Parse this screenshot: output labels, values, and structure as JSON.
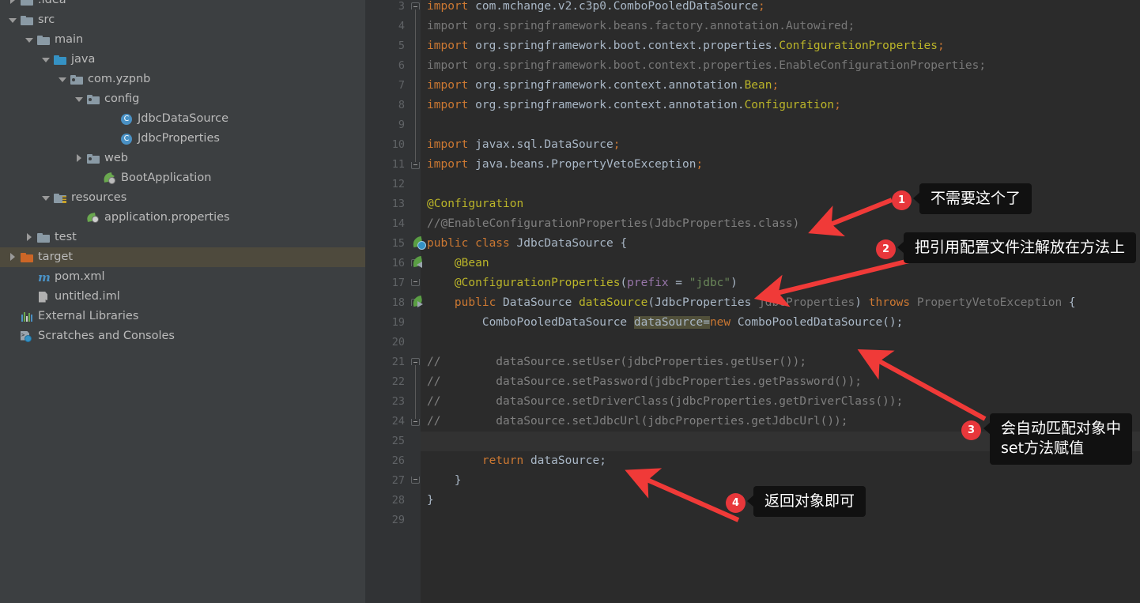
{
  "project_tree": {
    "rows": [
      {
        "label": ".idea",
        "indent": 0,
        "twisty": "right",
        "icon": "folder-icon",
        "cut": true
      },
      {
        "label": "src",
        "indent": 0,
        "twisty": "down",
        "icon": "folder-icon"
      },
      {
        "label": "main",
        "indent": 1,
        "twisty": "down",
        "icon": "folder-icon"
      },
      {
        "label": "java",
        "indent": 2,
        "twisty": "down",
        "icon": "folder-source-icon"
      },
      {
        "label": "com.yzpnb",
        "indent": 3,
        "twisty": "down",
        "icon": "package-icon"
      },
      {
        "label": "config",
        "indent": 4,
        "twisty": "down",
        "icon": "package-icon"
      },
      {
        "label": "JdbcDataSource",
        "indent": 6,
        "twisty": "none",
        "icon": "java-class-icon"
      },
      {
        "label": "JdbcProperties",
        "indent": 6,
        "twisty": "none",
        "icon": "java-class-icon"
      },
      {
        "label": "web",
        "indent": 4,
        "twisty": "right",
        "icon": "package-icon"
      },
      {
        "label": "BootApplication",
        "indent": 5,
        "twisty": "none",
        "icon": "spring-boot-app-icon"
      },
      {
        "label": "resources",
        "indent": 2,
        "twisty": "down",
        "icon": "folder-resources-icon"
      },
      {
        "label": "application.properties",
        "indent": 4,
        "twisty": "none",
        "icon": "spring-properties-icon"
      },
      {
        "label": "test",
        "indent": 1,
        "twisty": "right",
        "icon": "folder-icon"
      },
      {
        "label": "target",
        "indent": 0,
        "twisty": "right",
        "icon": "folder-excluded-icon",
        "selected": true
      },
      {
        "label": "pom.xml",
        "indent": 1,
        "twisty": "none",
        "icon": "maven-icon"
      },
      {
        "label": "untitled.iml",
        "indent": 1,
        "twisty": "none",
        "icon": "iml-file-icon"
      },
      {
        "label": "External Libraries",
        "indent": 0,
        "twisty": "none",
        "icon": "external-libraries-icon"
      },
      {
        "label": "Scratches and Consoles",
        "indent": 0,
        "twisty": "none",
        "icon": "scratches-icon"
      }
    ]
  },
  "editor": {
    "first_visible_line": 3,
    "caret_line": 25,
    "lines": [
      {
        "n": 3,
        "tokens": [
          {
            "t": "import ",
            "c": "kw"
          },
          {
            "t": "com.mchange.v2.c3p0.ComboPooledDataSource",
            "c": "typ"
          },
          {
            "t": ";",
            "c": "kw"
          }
        ]
      },
      {
        "n": 4,
        "tokens": [
          {
            "t": "import org.springframework.beans.factory.annotation.Autowired;",
            "c": "grey"
          }
        ]
      },
      {
        "n": 5,
        "tokens": [
          {
            "t": "import ",
            "c": "kw"
          },
          {
            "t": "org.springframework.boot.context.properties.",
            "c": "typ"
          },
          {
            "t": "ConfigurationProperties",
            "c": "ann"
          },
          {
            "t": ";",
            "c": "kw"
          }
        ]
      },
      {
        "n": 6,
        "tokens": [
          {
            "t": "import org.springframework.boot.context.properties.EnableConfigurationProperties;",
            "c": "grey"
          }
        ]
      },
      {
        "n": 7,
        "tokens": [
          {
            "t": "import ",
            "c": "kw"
          },
          {
            "t": "org.springframework.context.annotation.",
            "c": "typ"
          },
          {
            "t": "Bean",
            "c": "ann"
          },
          {
            "t": ";",
            "c": "kw"
          }
        ]
      },
      {
        "n": 8,
        "tokens": [
          {
            "t": "import ",
            "c": "kw"
          },
          {
            "t": "org.springframework.context.annotation.",
            "c": "typ"
          },
          {
            "t": "Configuration",
            "c": "ann"
          },
          {
            "t": ";",
            "c": "kw"
          }
        ]
      },
      {
        "n": 9,
        "tokens": []
      },
      {
        "n": 10,
        "tokens": [
          {
            "t": "import ",
            "c": "kw"
          },
          {
            "t": "javax.sql.DataSource",
            "c": "typ"
          },
          {
            "t": ";",
            "c": "kw"
          }
        ]
      },
      {
        "n": 11,
        "tokens": [
          {
            "t": "import ",
            "c": "kw"
          },
          {
            "t": "java.beans.PropertyVetoException",
            "c": "typ"
          },
          {
            "t": ";",
            "c": "kw"
          }
        ]
      },
      {
        "n": 12,
        "tokens": []
      },
      {
        "n": 13,
        "tokens": [
          {
            "t": "@Configuration",
            "c": "ann"
          }
        ]
      },
      {
        "n": 14,
        "tokens": [
          {
            "t": "//@EnableConfigurationProperties(JdbcProperties.class)",
            "c": "cmt"
          }
        ]
      },
      {
        "n": 15,
        "tokens": [
          {
            "t": "public class ",
            "c": "kw"
          },
          {
            "t": "JdbcDataSource",
            "c": "typ"
          },
          {
            "t": " {",
            "c": "typ"
          }
        ]
      },
      {
        "n": 16,
        "tokens": [
          {
            "t": "    ",
            "c": "typ"
          },
          {
            "t": "@Bean",
            "c": "ann"
          }
        ]
      },
      {
        "n": 17,
        "tokens": [
          {
            "t": "    ",
            "c": "typ"
          },
          {
            "t": "@ConfigurationProperties",
            "c": "ann"
          },
          {
            "t": "(",
            "c": "typ"
          },
          {
            "t": "prefix",
            "c": "fld"
          },
          {
            "t": " = ",
            "c": "typ"
          },
          {
            "t": "\"jdbc\"",
            "c": "str"
          },
          {
            "t": ")",
            "c": "typ"
          }
        ]
      },
      {
        "n": 18,
        "tokens": [
          {
            "t": "    ",
            "c": "typ"
          },
          {
            "t": "public ",
            "c": "kw"
          },
          {
            "t": "DataSource ",
            "c": "typ"
          },
          {
            "t": "dataSource",
            "c": "ann"
          },
          {
            "t": "(",
            "c": "typ"
          },
          {
            "t": "JdbcProperties ",
            "c": "typ"
          },
          {
            "t": "jdbcProperties",
            "c": "grey"
          },
          {
            "t": ") ",
            "c": "typ"
          },
          {
            "t": "throws ",
            "c": "kw"
          },
          {
            "t": "PropertyVetoException ",
            "c": "grey"
          },
          {
            "t": "{",
            "c": "typ"
          }
        ]
      },
      {
        "n": 19,
        "tokens": [
          {
            "t": "        ComboPooledDataSource ",
            "c": "typ"
          },
          {
            "t": "dataSource",
            "c": "typ hl"
          },
          {
            "t": "=",
            "c": "typ hl"
          },
          {
            "t": "new",
            "c": "kw"
          },
          {
            "t": " ComboPooledDataSource();",
            "c": "typ"
          }
        ]
      },
      {
        "n": 20,
        "tokens": []
      },
      {
        "n": 21,
        "tokens": [
          {
            "t": "//        dataSource.setUser(jdbcProperties.getUser());",
            "c": "cmt"
          }
        ]
      },
      {
        "n": 22,
        "tokens": [
          {
            "t": "//        dataSource.setPassword(jdbcProperties.getPassword());",
            "c": "cmt"
          }
        ]
      },
      {
        "n": 23,
        "tokens": [
          {
            "t": "//        dataSource.setDriverClass(jdbcProperties.getDriverClass());",
            "c": "cmt"
          }
        ]
      },
      {
        "n": 24,
        "tokens": [
          {
            "t": "//        dataSource.setJdbcUrl(jdbcProperties.getJdbcUrl());",
            "c": "cmt"
          }
        ]
      },
      {
        "n": 25,
        "tokens": []
      },
      {
        "n": 26,
        "tokens": [
          {
            "t": "        ",
            "c": "typ"
          },
          {
            "t": "return ",
            "c": "kw"
          },
          {
            "t": "dataSource;",
            "c": "typ"
          }
        ]
      },
      {
        "n": 27,
        "tokens": [
          {
            "t": "    }",
            "c": "typ"
          }
        ]
      },
      {
        "n": 28,
        "tokens": [
          {
            "t": "}",
            "c": "typ"
          }
        ]
      },
      {
        "n": 29,
        "tokens": []
      }
    ]
  },
  "annotations": [
    {
      "number": "1",
      "text": "不需要这个了"
    },
    {
      "number": "2",
      "text": "把引用配置文件注解放在方法上"
    },
    {
      "number": "3",
      "text": "会自动匹配对象中\nset方法赋值"
    },
    {
      "number": "4",
      "text": "返回对象即可"
    }
  ],
  "colors": {
    "accent_red": "#e8373b",
    "editor_bg": "#2b2b2b",
    "gutter_bg": "#313335",
    "tree_bg": "#3c3f41",
    "selection": "#4e4a3d",
    "callout_bg": "#111111"
  }
}
